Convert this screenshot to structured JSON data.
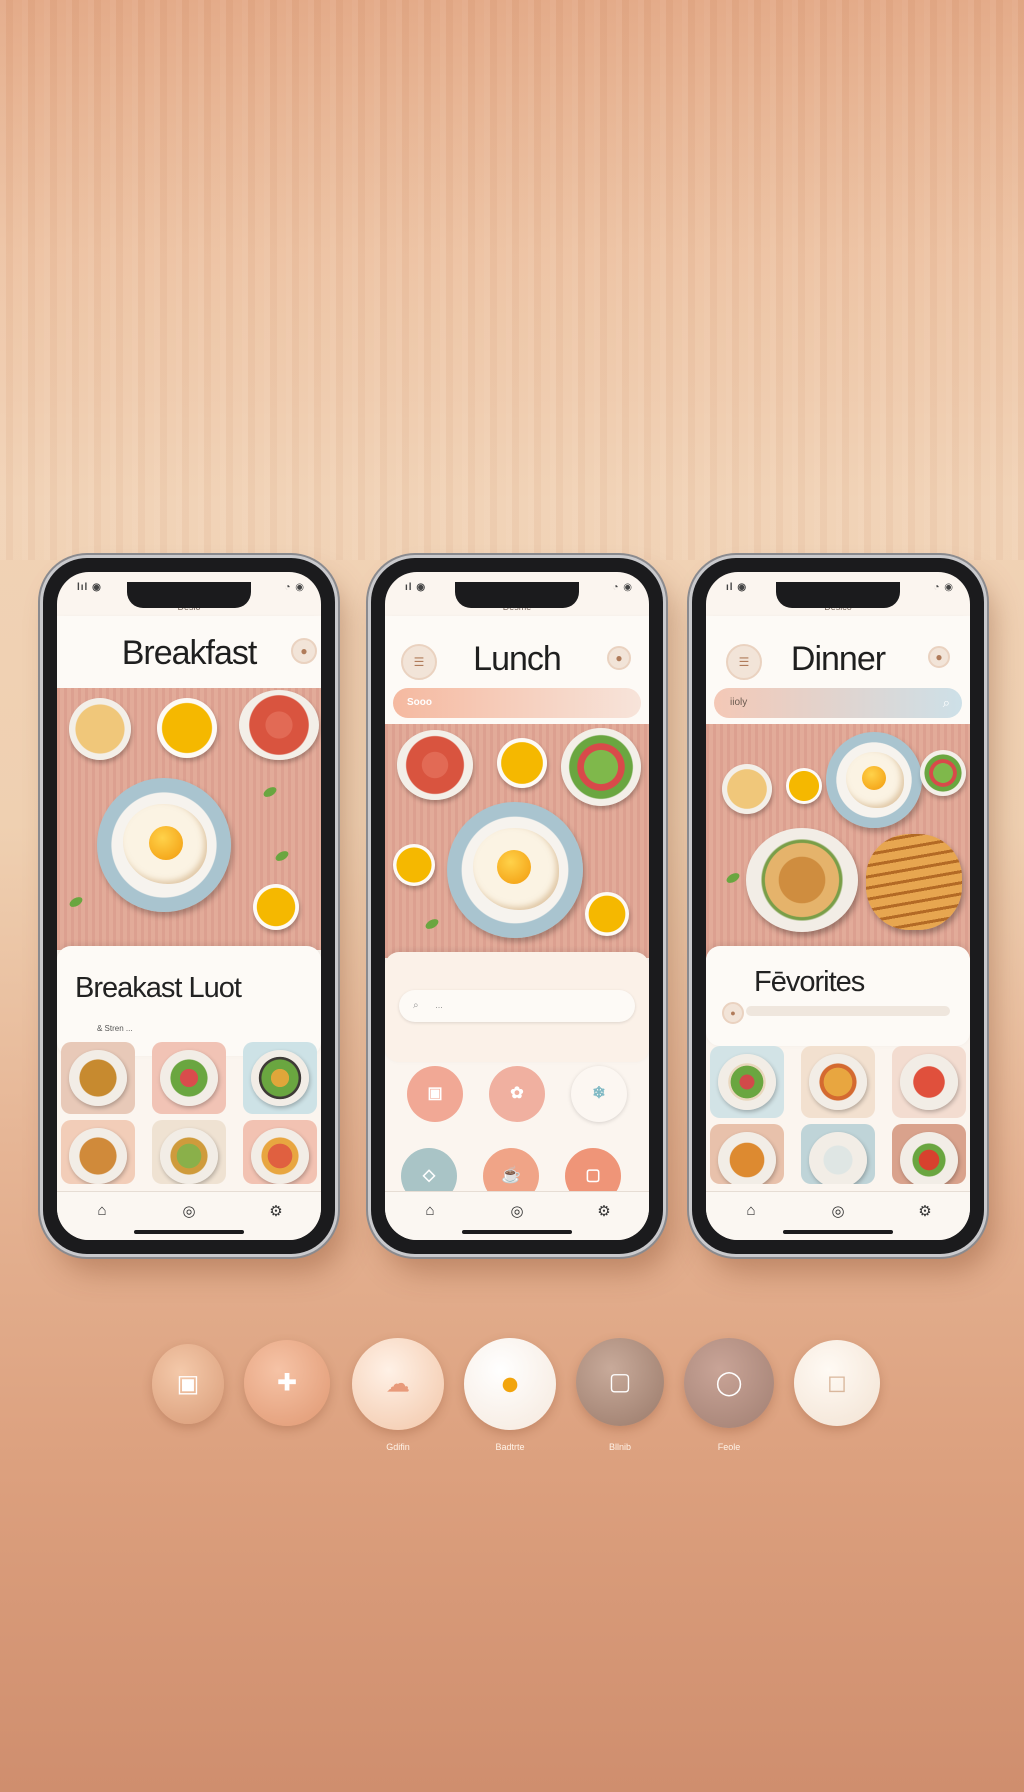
{
  "phones": [
    {
      "status_left": "lıl ◉",
      "status_right": "◔ ◉",
      "mini_label": "Desio",
      "title": "Breakfast",
      "card_title": "Breakast Luot",
      "card_subtitle": "& Stren ..."
    },
    {
      "status_left": "ıl ◉",
      "status_right": "◔ ◉",
      "mini_label": "Desme",
      "title": "Lunch",
      "search_chip": "Sooo",
      "card_subtitle": "…"
    },
    {
      "status_left": "ıl ◉",
      "status_right": "◔ ◉",
      "mini_label": "Desico",
      "title": "Dinner",
      "search_chip": "iioly",
      "card_title": "Fēvorites"
    }
  ],
  "icon_row": {
    "captions": [
      "Gdifin",
      "Badtrte",
      "Bllnib",
      "Feole"
    ]
  },
  "colors": {
    "background_top": "#e3a986",
    "background_mid": "#f1d2b5",
    "background_bottom": "#cf8e6e",
    "accent_peach": "#f0a78e",
    "accent_yolk": "#f2a40c"
  }
}
